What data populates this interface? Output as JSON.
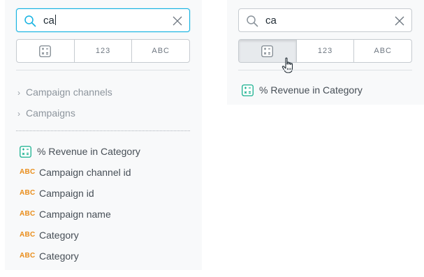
{
  "left": {
    "search": {
      "value": "ca"
    },
    "filters": [
      {
        "label": "",
        "icon": "calculator-icon",
        "active": false
      },
      {
        "label": "123",
        "active": false
      },
      {
        "label": "ABC",
        "active": false
      }
    ],
    "folders": [
      {
        "label": "Campaign channels"
      },
      {
        "label": "Campaigns"
      }
    ],
    "fields": [
      {
        "type": "metric",
        "label": "% Revenue in Category"
      },
      {
        "type": "attribute",
        "type_label": "ABC",
        "label": "Campaign channel id"
      },
      {
        "type": "attribute",
        "type_label": "ABC",
        "label": "Campaign id"
      },
      {
        "type": "attribute",
        "type_label": "ABC",
        "label": "Campaign name"
      },
      {
        "type": "attribute",
        "type_label": "ABC",
        "label": "Category"
      },
      {
        "type": "attribute",
        "type_label": "ABC",
        "label": "Category"
      }
    ]
  },
  "right": {
    "search": {
      "value": "ca"
    },
    "filters": [
      {
        "label": "",
        "icon": "calculator-icon",
        "active": true
      },
      {
        "label": "123",
        "active": false
      },
      {
        "label": "ABC",
        "active": false
      }
    ],
    "fields": [
      {
        "type": "metric",
        "label": "% Revenue in Category"
      }
    ]
  },
  "colors": {
    "focus_border": "#14b2e2",
    "metric_icon": "#17b08e",
    "attribute_icon": "#e98d1a"
  }
}
